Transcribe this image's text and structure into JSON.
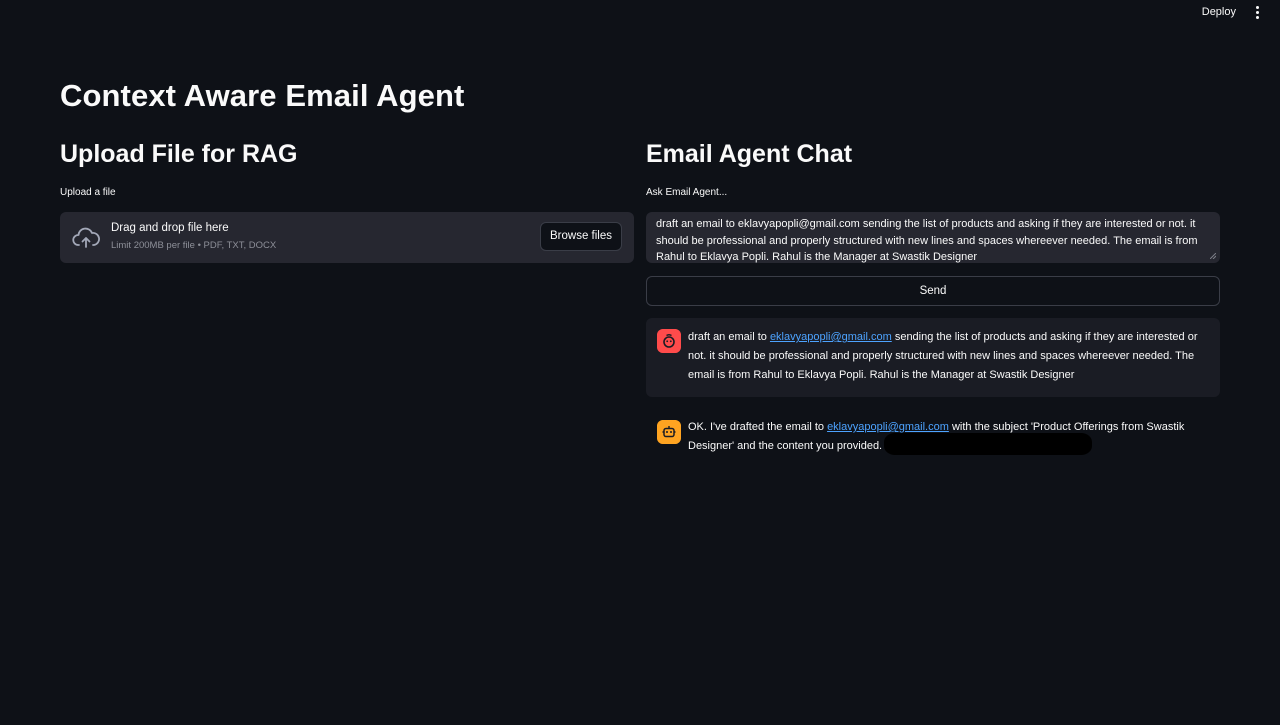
{
  "header": {
    "deploy_label": "Deploy",
    "menu_icon": "kebab-menu-icon"
  },
  "page": {
    "title": "Context Aware Email Agent"
  },
  "upload": {
    "heading": "Upload File for RAG",
    "label": "Upload a file",
    "drop_text": "Drag and drop file here",
    "limit_text": "Limit 200MB per file • PDF, TXT, DOCX",
    "browse_label": "Browse files",
    "icon": "cloud-upload-icon"
  },
  "chat": {
    "heading": "Email Agent Chat",
    "input_label": "Ask Email Agent...",
    "input_value": "draft an email to eklavyapopli@gmail.com sending the list of products and asking if they are interested or not. it should be professional and properly structured with new lines and spaces whereever needed. The email is from Rahul to Eklavya Popli. Rahul is the Manager at Swastik Designer",
    "send_label": "Send",
    "messages": [
      {
        "role": "user",
        "avatar_icon": "user-face-icon",
        "prefix": "draft an email to ",
        "link": "eklavyapopli@gmail.com",
        "suffix": " sending the list of products and asking if they are interested or not. it should be professional and properly structured with new lines and spaces whereever needed. The email is from Rahul to Eklavya Popli. Rahul is the Manager at Swastik Designer"
      },
      {
        "role": "assistant",
        "avatar_icon": "robot-icon",
        "prefix": "OK. I've drafted the email to ",
        "link": "eklavyapopli@gmail.com",
        "suffix": " with the subject 'Product Offerings from Swastik Designer' and the content you provided."
      }
    ]
  },
  "colors": {
    "background": "#0e1117",
    "surface": "#262730",
    "user_avatar": "#ff4b4b",
    "assistant_avatar": "#ffa421",
    "link": "#4da3ff"
  }
}
